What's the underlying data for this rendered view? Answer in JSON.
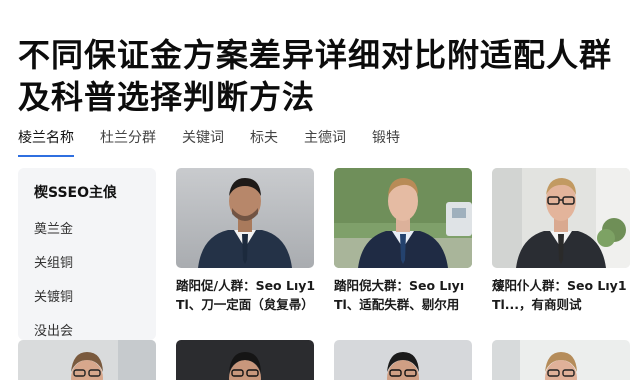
{
  "page": {
    "title": "不同保证金方案差异详细对比附适配人群及科普选择判断方法"
  },
  "tabs": [
    {
      "label": "棱兰名称"
    },
    {
      "label": "杜兰分群"
    },
    {
      "label": "关键词"
    },
    {
      "label": "标夫"
    },
    {
      "label": "主德词"
    },
    {
      "label": "锻特"
    }
  ],
  "sidebar": {
    "title": "楔SSEO主俍",
    "items": [
      {
        "label": "奠兰金"
      },
      {
        "label": "关组铜"
      },
      {
        "label": "关镀铜"
      },
      {
        "label": "没出会"
      }
    ]
  },
  "cards": [
    {
      "line1": "踏阳促/人群：Seo Lıy1",
      "line2": "Tl、刀一定面（炱复帚）"
    },
    {
      "line1": "踏阳倪大群：Seo Lıyı",
      "line2": "Tl、适配失群、剔尔用"
    },
    {
      "line1": "蕿阳仆人群：Seo Lıy1",
      "line2": "Tl...，有商则试"
    }
  ]
}
